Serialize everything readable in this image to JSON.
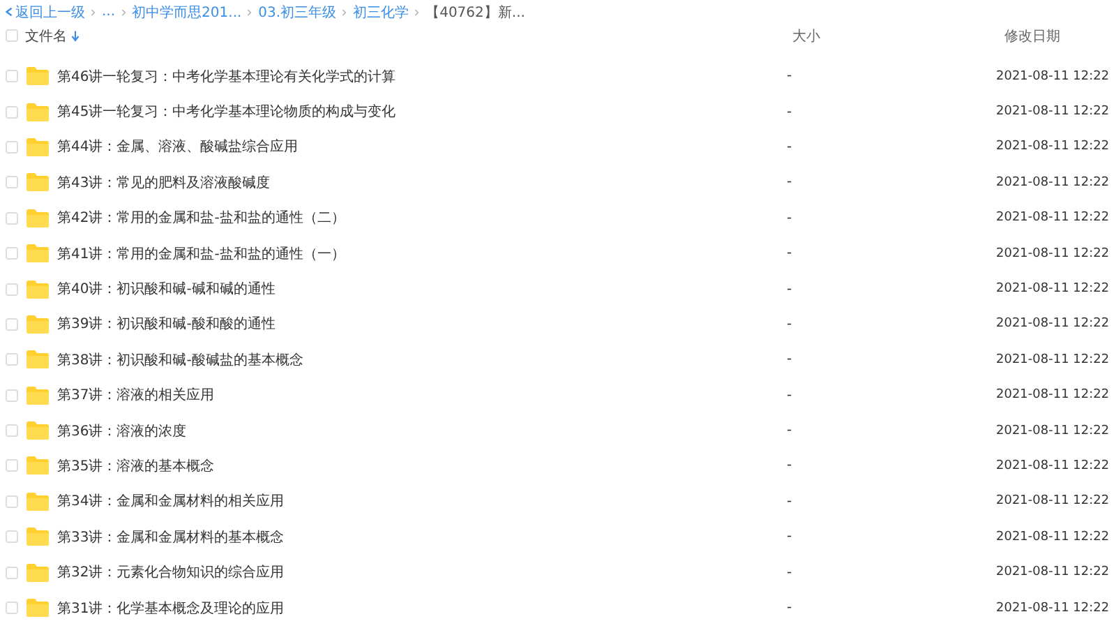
{
  "breadcrumb": {
    "back": "返回上一级",
    "items": [
      "...",
      "初中学而思201...",
      "03.初三年级",
      "初三化学",
      "【40762】新..."
    ]
  },
  "table": {
    "select_all_checked": false,
    "columns": [
      {
        "label": "文件名",
        "sorted": true
      },
      {
        "label": "大小",
        "sorted": false
      },
      {
        "label": "修改日期",
        "sorted": false
      }
    ],
    "rows": [
      {
        "name": "第46讲一轮复习：中考化学基本理论有关化学式的计算",
        "size": "-",
        "modified": "2021-08-11 12:22",
        "checked": false
      },
      {
        "name": "第45讲一轮复习：中考化学基本理论物质的构成与变化",
        "size": "-",
        "modified": "2021-08-11 12:22",
        "checked": false
      },
      {
        "name": "第44讲：金属、溶液、酸碱盐综合应用",
        "size": "-",
        "modified": "2021-08-11 12:22",
        "checked": false
      },
      {
        "name": "第43讲：常见的肥料及溶液酸碱度",
        "size": "-",
        "modified": "2021-08-11 12:22",
        "checked": false
      },
      {
        "name": "第42讲：常用的金属和盐-盐和盐的通性（二）",
        "size": "-",
        "modified": "2021-08-11 12:22",
        "checked": false
      },
      {
        "name": "第41讲：常用的金属和盐-盐和盐的通性（一）",
        "size": "-",
        "modified": "2021-08-11 12:22",
        "checked": false
      },
      {
        "name": "第40讲：初识酸和碱-碱和碱的通性",
        "size": "-",
        "modified": "2021-08-11 12:22",
        "checked": false
      },
      {
        "name": "第39讲：初识酸和碱-酸和酸的通性",
        "size": "-",
        "modified": "2021-08-11 12:22",
        "checked": false
      },
      {
        "name": "第38讲：初识酸和碱-酸碱盐的基本概念",
        "size": "-",
        "modified": "2021-08-11 12:22",
        "checked": false
      },
      {
        "name": "第37讲：溶液的相关应用",
        "size": "-",
        "modified": "2021-08-11 12:22",
        "checked": false
      },
      {
        "name": "第36讲：溶液的浓度",
        "size": "-",
        "modified": "2021-08-11 12:22",
        "checked": false
      },
      {
        "name": "第35讲：溶液的基本概念",
        "size": "-",
        "modified": "2021-08-11 12:22",
        "checked": false
      },
      {
        "name": "第34讲：金属和金属材料的相关应用",
        "size": "-",
        "modified": "2021-08-11 12:22",
        "checked": false
      },
      {
        "name": "第33讲：金属和金属材料的基本概念",
        "size": "-",
        "modified": "2021-08-11 12:22",
        "checked": false
      },
      {
        "name": "第32讲：元素化合物知识的综合应用",
        "size": "-",
        "modified": "2021-08-11 12:22",
        "checked": false
      },
      {
        "name": "第31讲：化学基本概念及理论的应用",
        "size": "-",
        "modified": "2021-08-11 12:22",
        "checked": false
      }
    ]
  }
}
